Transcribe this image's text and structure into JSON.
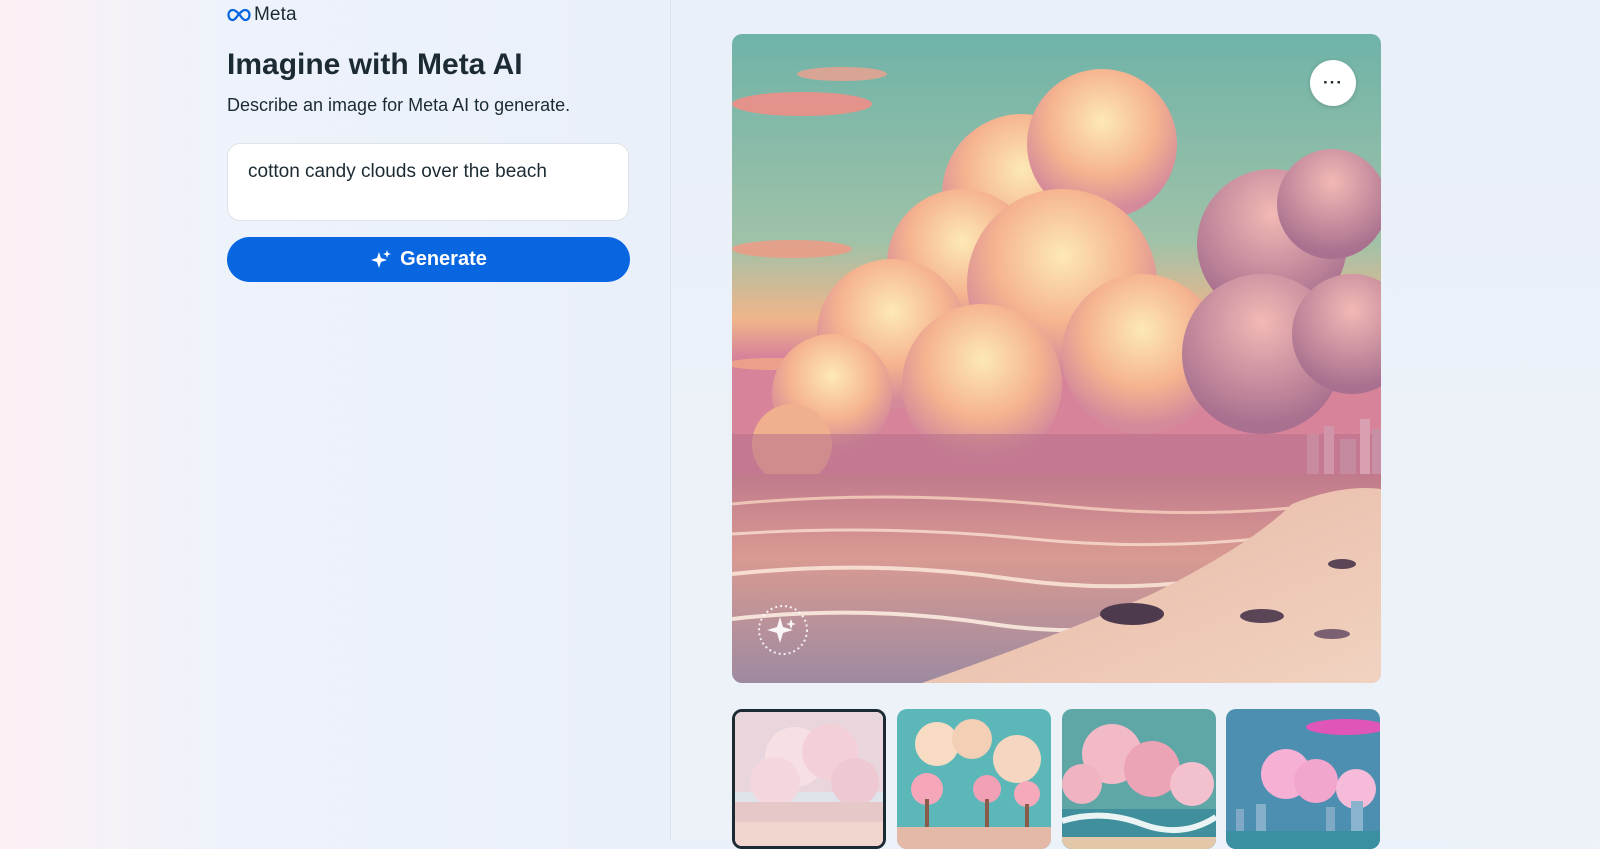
{
  "brand": {
    "name": "Meta",
    "icon": "meta-infinity-icon",
    "color": "#0866e0"
  },
  "header": {
    "title": "Imagine with Meta AI",
    "subtitle": "Describe an image for Meta AI to generate."
  },
  "prompt": {
    "value": "cotton candy clouds over the beach"
  },
  "generate_button": {
    "label": "Generate",
    "icon": "sparkle-icon",
    "color": "#0866e0"
  },
  "preview": {
    "more_button_label": "···",
    "more_button_icon": "more-options-icon",
    "watermark_icon": "imagined-with-ai-icon"
  },
  "thumbnails": [
    {
      "selected": true
    },
    {
      "selected": false
    },
    {
      "selected": false
    },
    {
      "selected": false
    }
  ]
}
